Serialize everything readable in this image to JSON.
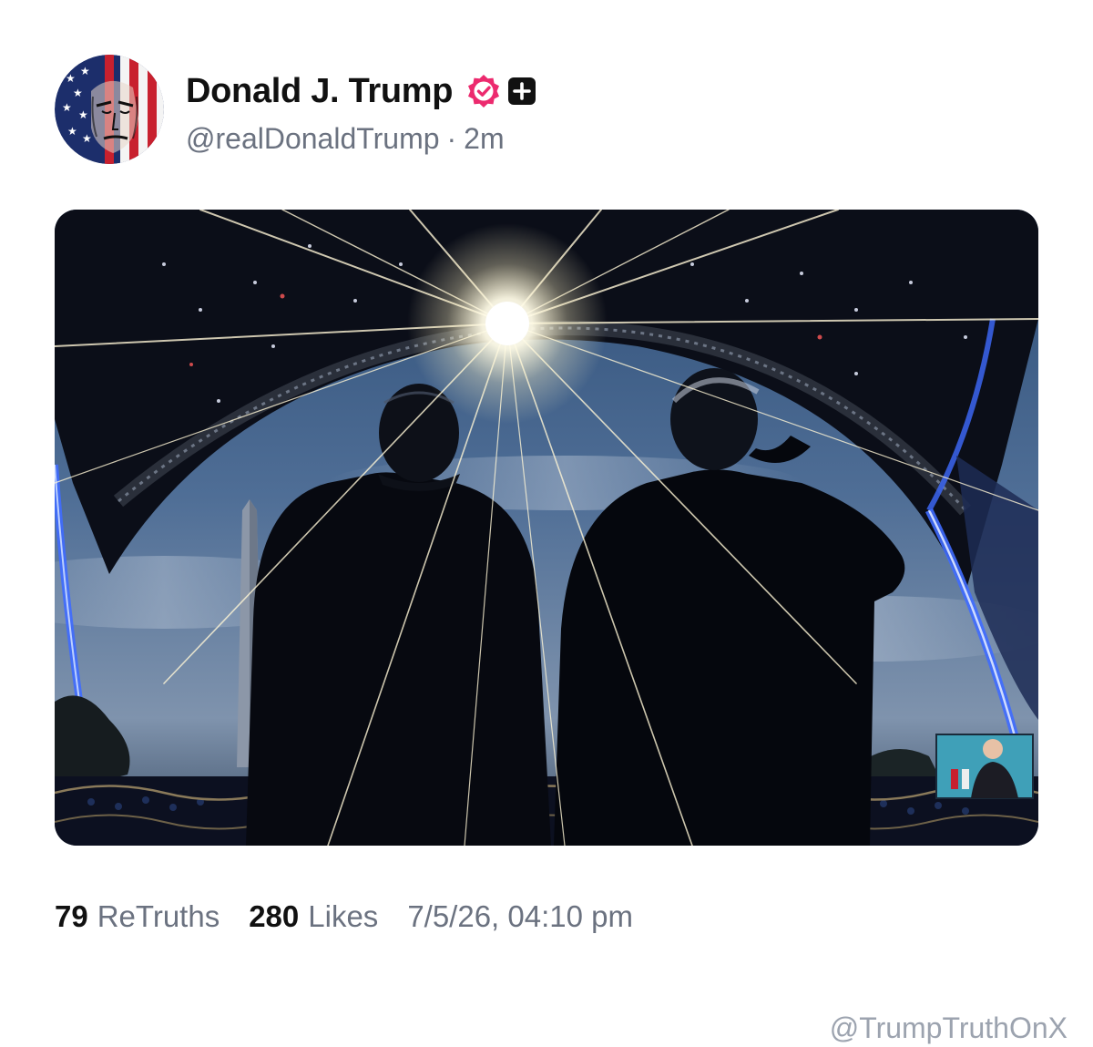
{
  "author": {
    "display_name": "Donald J. Trump",
    "handle": "@realDonaldTrump",
    "separator": "·",
    "time_ago": "2m",
    "avatar_icon": "avatar-flag-portrait-icon",
    "verified_icon": "verified-badge-icon",
    "verified_color": "#ec2a6e",
    "extra_badge_icon": "plus-badge-icon"
  },
  "media": {
    "type": "photo"
  },
  "stats": {
    "retruths_count": "79",
    "retruths_label": "ReTruths",
    "likes_count": "280",
    "likes_label": "Likes",
    "timestamp": "7/5/26, 04:10 pm"
  },
  "watermark": "@TrumpTruthOnX",
  "colors": {
    "text_primary": "#111111",
    "text_secondary": "#6b7280",
    "watermark": "#9ca3af"
  }
}
